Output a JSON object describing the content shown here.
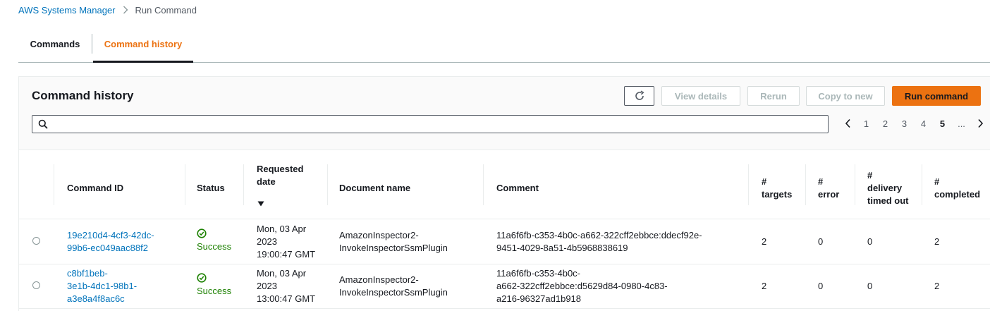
{
  "breadcrumb": {
    "parent": "AWS Systems Manager",
    "current": "Run Command"
  },
  "tabs": [
    {
      "label": "Commands"
    },
    {
      "label": "Command history"
    }
  ],
  "panel": {
    "title": "Command history",
    "buttons": {
      "view_details": "View details",
      "rerun": "Rerun",
      "copy_to_new": "Copy to new",
      "run_command": "Run command"
    },
    "search": {
      "value": "",
      "placeholder": ""
    },
    "pagination": {
      "pages": [
        "1",
        "2",
        "3",
        "4",
        "5"
      ],
      "current": "5",
      "ellipsis": "..."
    }
  },
  "table": {
    "headers": {
      "command_id": "Command ID",
      "status": "Status",
      "requested_date_1": "Requested",
      "requested_date_2": "date",
      "document_name": "Document name",
      "comment": "Comment",
      "targets_1": "#",
      "targets_2": "targets",
      "error_1": "#",
      "error_2": "error",
      "delivery_1": "#",
      "delivery_2": "delivery",
      "delivery_3": "timed out",
      "completed_1": "#",
      "completed_2": "completed"
    },
    "rows": [
      {
        "id_lines": [
          "19e210d4-4cf3-42dc-",
          "99b6-ec049aac88f2"
        ],
        "status": "Success",
        "date_lines": [
          "Mon, 03 Apr",
          "2023",
          "19:00:47 GMT"
        ],
        "doc_lines": [
          "AmazonInspector2-",
          "InvokeInspectorSsmPlugin"
        ],
        "comment_lines": [
          "11a6f6fb-c353-4b0c-a662-322cff2ebbce:ddecf92e-",
          "9451-4029-8a51-4b5968838619"
        ],
        "targets": "2",
        "error": "0",
        "delivery_timed_out": "0",
        "completed": "2"
      },
      {
        "id_lines": [
          "c8bf1beb-",
          "3e1b-4dc1-98b1-",
          "a3e8a4f8ac6c"
        ],
        "status": "Success",
        "date_lines": [
          "Mon, 03 Apr",
          "2023",
          "13:00:47 GMT"
        ],
        "doc_lines": [
          "AmazonInspector2-",
          "InvokeInspectorSsmPlugin"
        ],
        "comment_lines": [
          "11a6f6fb-c353-4b0c-",
          "a662-322cff2ebbce:d5629d84-0980-4c83-",
          "a216-96327ad1b918"
        ],
        "targets": "2",
        "error": "0",
        "delivery_timed_out": "0",
        "completed": "2"
      }
    ]
  },
  "colors": {
    "accent": "#ec7211",
    "link": "#0073bb",
    "success": "#1d8102",
    "text": "#16191f"
  },
  "icons": {
    "breadcrumb_separator": "chevron-right-icon",
    "refresh": "refresh-icon",
    "search": "search-icon",
    "sort": "caret-down-icon",
    "prev": "chevron-left-icon",
    "next": "chevron-right-icon",
    "status": "check-circle-icon"
  }
}
